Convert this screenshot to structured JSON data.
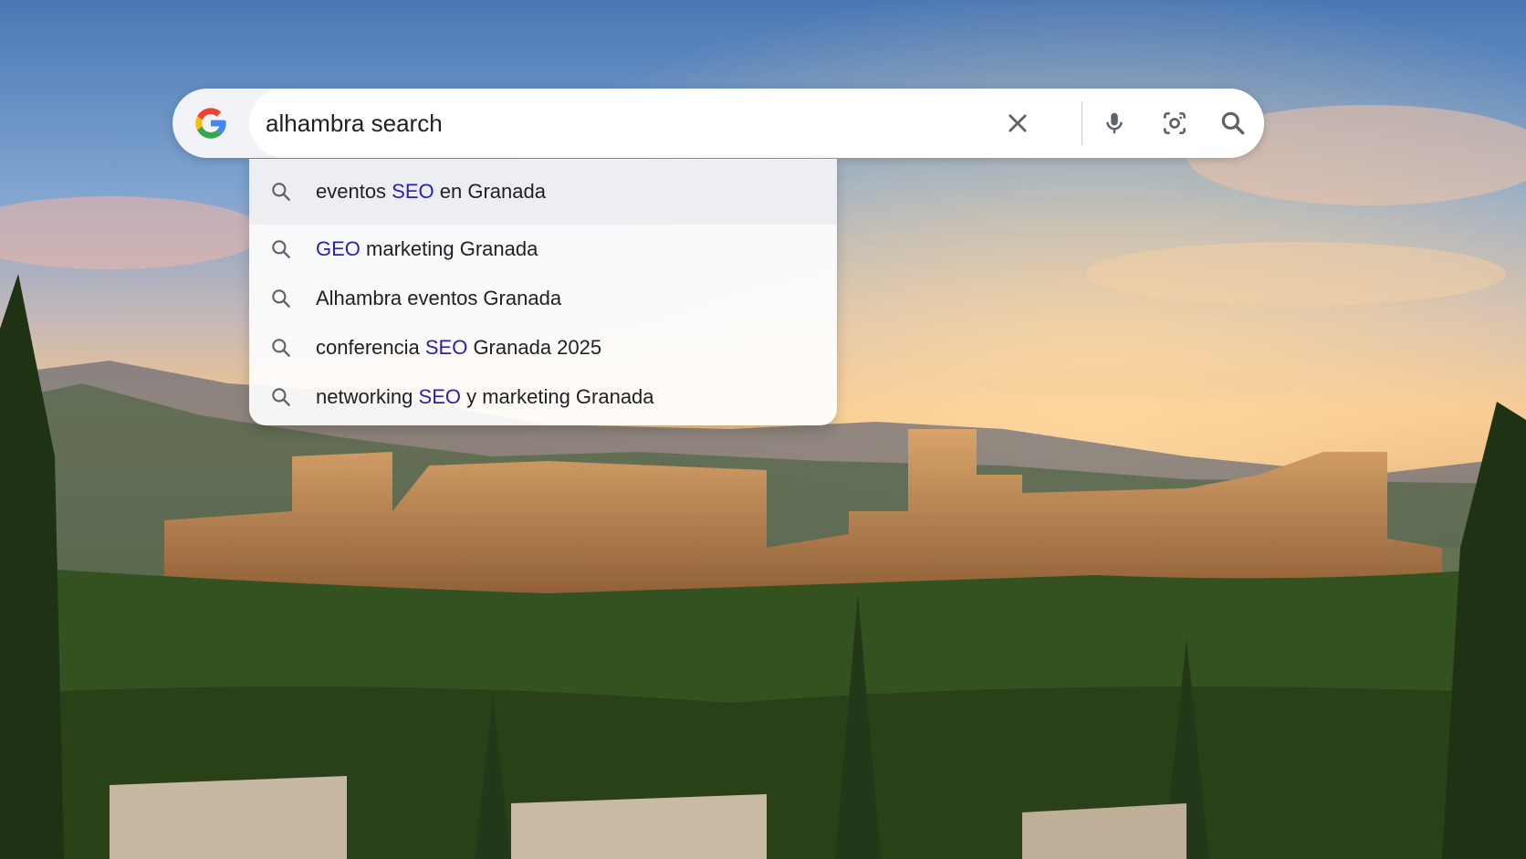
{
  "colors": {
    "keyword": "#2a1fb5",
    "text": "#202124",
    "icon": "#5f6368",
    "google_blue": "#4285F4",
    "google_red": "#EA4335",
    "google_yellow": "#FBBC05",
    "google_green": "#34A853"
  },
  "search": {
    "query": "alhambra search",
    "icons": {
      "logo": "google-g-logo",
      "clear": "close-icon",
      "voice": "microphone-icon",
      "lens": "camera-lens-icon",
      "submit": "search-icon"
    }
  },
  "suggestions": [
    {
      "pre": "eventos ",
      "kw": "SEO",
      "post": " en Granada"
    },
    {
      "pre": "",
      "kw": "GEO",
      "post": " marketing Granada"
    },
    {
      "pre": "Alhambra eventos Granada",
      "kw": "",
      "post": ""
    },
    {
      "pre": "conferencia ",
      "kw": "SEO",
      "post": " Granada 2025"
    },
    {
      "pre": "networking ",
      "kw": "SEO",
      "post": " y marketing Granada"
    }
  ]
}
